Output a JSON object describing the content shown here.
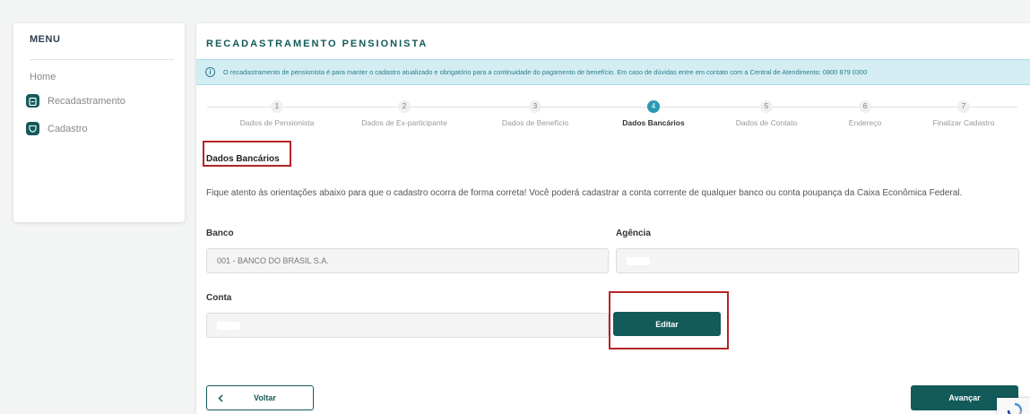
{
  "sidebar": {
    "menu_title": "MENU",
    "home": "Home",
    "items": [
      {
        "label": "Recadastramento",
        "icon": "clipboard-icon"
      },
      {
        "label": "Cadastro",
        "icon": "shield-icon"
      }
    ]
  },
  "main": {
    "title": "RECADASTRAMENTO PENSIONISTA",
    "info_banner": "O recadastramento de pensionista é para manter o cadastro atualizado e obrigatório para a continuidade do pagamento de benefício. Em caso de dúvidas entre em contato com a Central de Atendimento: 0800 879 0300",
    "steps": [
      {
        "number": "1",
        "label": "Dados de Pensionista"
      },
      {
        "number": "2",
        "label": "Dados de Ex-participante"
      },
      {
        "number": "3",
        "label": "Dados de Benefício"
      },
      {
        "number": "4",
        "label": "Dados Bancários",
        "active": true
      },
      {
        "number": "5",
        "label": "Dados de Contato"
      },
      {
        "number": "6",
        "label": "Endereço"
      },
      {
        "number": "7",
        "label": "Finalizar Cadastro"
      }
    ],
    "section_heading": "Dados Bancários",
    "instruction": "Fique atento às orientações abaixo para que o cadastro ocorra de forma correta! Você poderá cadastrar a conta corrente de qualquer banco ou conta poupança da Caixa Econômica Federal.",
    "fields": {
      "banco_label": "Banco",
      "banco_value": "001 - BANCO DO BRASIL S.A.",
      "agencia_label": "Agência",
      "conta_label": "Conta"
    },
    "edit_button": "Editar",
    "back_button": "Voltar",
    "next_button": "Avançar"
  },
  "colors": {
    "primary": "#135a5a",
    "active_step": "#2a9ab5",
    "banner_bg": "#d3edf2",
    "highlight": "#b72424"
  }
}
